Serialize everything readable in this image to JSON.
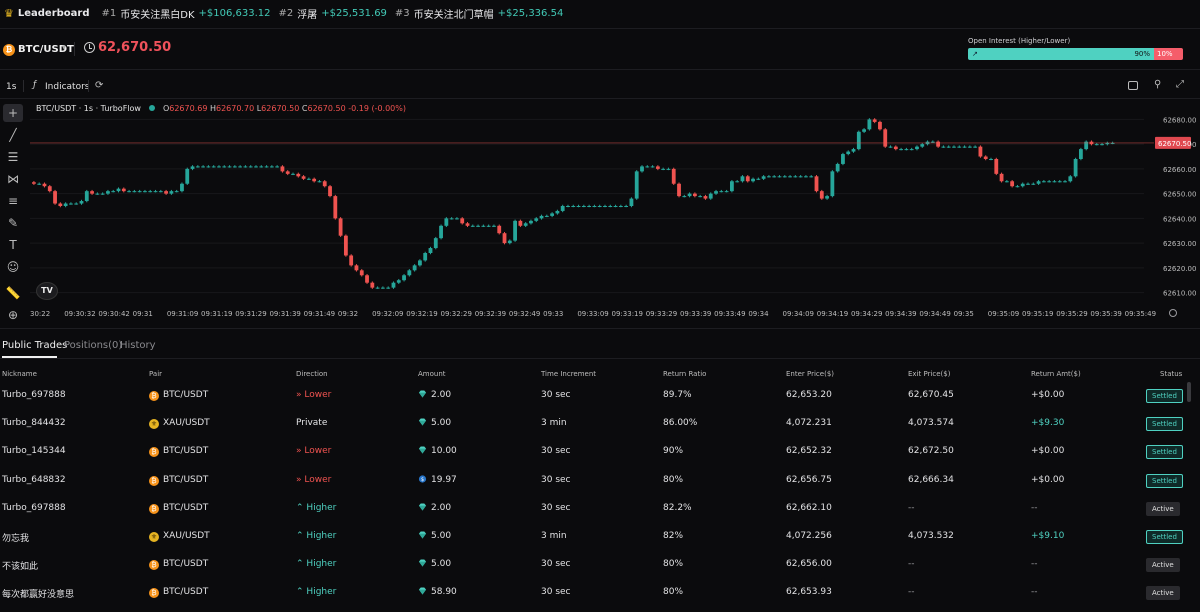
{
  "topbar": {
    "label": "Leaderboard",
    "entries": [
      {
        "rank": "#1",
        "nick": "币安关注黑白DK",
        "amount": "+$106,633.12"
      },
      {
        "rank": "#2",
        "nick": "浮屠",
        "amount": "+$25,531.69"
      },
      {
        "rank": "#3",
        "nick": "币安关注北门草帽",
        "amount": "+$25,336.54"
      }
    ]
  },
  "pair": {
    "symbol_icon": "₿",
    "name": "BTC/USDT",
    "price": "62,670.50"
  },
  "open_interest": {
    "label": "Open Interest (Higher/Lower)",
    "higher": "90%",
    "lower": "10%",
    "higher_fraction": 0.9
  },
  "toolbar": {
    "interval": "1s",
    "indicators": "Indicators"
  },
  "legend": {
    "title": "BTC/USDT · 1s · TurboFlow",
    "o_label": "O",
    "o": "62670.69",
    "h_label": "H",
    "h": "62670.70",
    "l_label": "L",
    "l": "62670.50",
    "c_label": "C",
    "c": "62670.50",
    "change": "-0.19 (-0.00%)"
  },
  "chart_data": {
    "type": "candlestick",
    "y_ticks": [
      62680,
      62670,
      62660,
      62650,
      62640,
      62630,
      62620,
      62610
    ],
    "y_tick_labels": [
      "62680.00",
      "62670.00",
      "62660.00",
      "62650.00",
      "62640.00",
      "62630.00",
      "62620.00",
      "62610.00"
    ],
    "ylim": [
      62607,
      62683
    ],
    "current_price_label": "62670.50",
    "current_price": 62670.5,
    "x_tick_labels": [
      "30:22",
      "09:30:32",
      "09:30:42",
      "09:31",
      "09:31:09",
      "09:31:19",
      "09:31:29",
      "09:31:39",
      "09:31:49",
      "09:32",
      "09:32:09",
      "09:32:19",
      "09:32:29",
      "09:32:39",
      "09:32:49",
      "09:33",
      "09:33:09",
      "09:33:19",
      "09:33:29",
      "09:33:39",
      "09:33:49",
      "09:34",
      "09:34:09",
      "09:34:19",
      "09:34:29",
      "09:34:39",
      "09:34:49",
      "09:35",
      "09:35:09",
      "09:35:19",
      "09:35:29",
      "09:35:39",
      "09:35:49"
    ],
    "closes": [
      62654,
      62654,
      62653,
      62651,
      62646,
      62645,
      62646,
      62646,
      62646,
      62647,
      62651,
      62650,
      62650,
      62650,
      62651,
      62651,
      62652,
      62651,
      62651,
      62651,
      62651,
      62651,
      62651,
      62651,
      62651,
      62650,
      62651,
      62651,
      62654,
      62660,
      62661,
      62661,
      62661,
      62661,
      62661,
      62661,
      62661,
      62661,
      62661,
      62661,
      62661,
      62661,
      62661,
      62661,
      62661,
      62661,
      62661,
      62659,
      62658,
      62658,
      62657,
      62656,
      62656,
      62655,
      62655,
      62653,
      62649,
      62640,
      62633,
      62625,
      62621,
      62619,
      62617,
      62614,
      62612,
      62612,
      62612,
      62612,
      62614,
      62615,
      62617,
      62619,
      62621,
      62623,
      62626,
      62628,
      62632,
      62637,
      62640,
      62640,
      62640,
      62638,
      62637,
      62637,
      62637,
      62637,
      62637,
      62637,
      62634,
      62630,
      62631,
      62639,
      62637,
      62638,
      62639,
      62640,
      62641,
      62641,
      62642,
      62643,
      62645,
      62645,
      62645,
      62645,
      62645,
      62645,
      62645,
      62645,
      62645,
      62645,
      62645,
      62645,
      62645,
      62648,
      62659,
      62661,
      62661,
      62661,
      62660,
      62660,
      62660,
      62654,
      62649,
      62649,
      62650,
      62649,
      62649,
      62648,
      62650,
      62651,
      62651,
      62651,
      62655,
      62655,
      62657,
      62655,
      62656,
      62656,
      62657,
      62657,
      62657,
      62657,
      62657,
      62657,
      62657,
      62657,
      62657,
      62657,
      62651,
      62648,
      62649,
      62659,
      62662,
      62666,
      62667,
      62668,
      62675,
      62676,
      62680,
      62679,
      62676,
      62669,
      62669,
      62668,
      62668,
      62668,
      62668,
      62669,
      62670,
      62671,
      62671,
      62669,
      62669,
      62669,
      62669,
      62669,
      62669,
      62669,
      62669,
      62665,
      62664,
      62664,
      62658,
      62655,
      62655,
      62653,
      62653,
      62654,
      62654,
      62654,
      62655,
      62655,
      62655,
      62655,
      62655,
      62655,
      62657,
      62664,
      62668,
      62671,
      62670,
      62670,
      62670,
      62670.5,
      62670.5
    ]
  },
  "tabs": [
    "Public Trades",
    "Positions(0)",
    "History"
  ],
  "table": {
    "headers": [
      "Nickname",
      "Pair",
      "Direction",
      "Amount",
      "Time Increment",
      "Return Ratio",
      "Enter Price($)",
      "Exit Price($)",
      "Return Amt($)",
      "Status"
    ],
    "rows": [
      {
        "nickname": "Turbo_697888",
        "pair": "BTC/USDT",
        "coin": "btc",
        "direction": "Lower",
        "dir": "lower",
        "amount": "2.00",
        "amt_icon": "gem",
        "time": "30 sec",
        "ratio": "89.7%",
        "enter": "62,653.20",
        "exit": "62,670.45",
        "ret": "+$0.00",
        "ret_color": "white",
        "status": "Settled"
      },
      {
        "nickname": "Turbo_844432",
        "pair": "XAU/USDT",
        "coin": "xau",
        "direction": "Private",
        "dir": "private",
        "amount": "5.00",
        "amt_icon": "gem",
        "time": "3 min",
        "ratio": "86.00%",
        "enter": "4,072.231",
        "exit": "4,073.574",
        "ret": "+$9.30",
        "ret_color": "green",
        "status": "Settled"
      },
      {
        "nickname": "Turbo_145344",
        "pair": "BTC/USDT",
        "coin": "btc",
        "direction": "Lower",
        "dir": "lower",
        "amount": "10.00",
        "amt_icon": "gem",
        "time": "30 sec",
        "ratio": "90%",
        "enter": "62,652.32",
        "exit": "62,672.50",
        "ret": "+$0.00",
        "ret_color": "white",
        "status": "Settled"
      },
      {
        "nickname": "Turbo_648832",
        "pair": "BTC/USDT",
        "coin": "btc",
        "direction": "Lower",
        "dir": "lower",
        "amount": "19.97",
        "amt_icon": "usdc",
        "time": "30 sec",
        "ratio": "80%",
        "enter": "62,656.75",
        "exit": "62,666.34",
        "ret": "+$0.00",
        "ret_color": "white",
        "status": "Settled"
      },
      {
        "nickname": "Turbo_697888",
        "pair": "BTC/USDT",
        "coin": "btc",
        "direction": "Higher",
        "dir": "higher",
        "amount": "2.00",
        "amt_icon": "gem",
        "time": "30 sec",
        "ratio": "82.2%",
        "enter": "62,662.10",
        "exit": "--",
        "ret": "--",
        "ret_color": "dim",
        "status": "Active"
      },
      {
        "nickname": "勿忘我",
        "pair": "XAU/USDT",
        "coin": "xau",
        "direction": "Higher",
        "dir": "higher",
        "amount": "5.00",
        "amt_icon": "gem",
        "time": "3 min",
        "ratio": "82%",
        "enter": "4,072.256",
        "exit": "4,073.532",
        "ret": "+$9.10",
        "ret_color": "green",
        "status": "Settled"
      },
      {
        "nickname": "不该如此",
        "pair": "BTC/USDT",
        "coin": "btc",
        "direction": "Higher",
        "dir": "higher",
        "amount": "5.00",
        "amt_icon": "gem",
        "time": "30 sec",
        "ratio": "80%",
        "enter": "62,656.00",
        "exit": "--",
        "ret": "--",
        "ret_color": "dim",
        "status": "Active"
      },
      {
        "nickname": "每次都赢好没意思",
        "pair": "BTC/USDT",
        "coin": "btc",
        "direction": "Higher",
        "dir": "higher",
        "amount": "58.90",
        "amt_icon": "gem",
        "time": "30 sec",
        "ratio": "80%",
        "enter": "62,653.93",
        "exit": "--",
        "ret": "--",
        "ret_color": "dim",
        "status": "Active"
      }
    ]
  },
  "colors": {
    "up": "#26a69a",
    "down": "#ef5350",
    "price_line": "#ef5350",
    "accent": "#4fd1c1",
    "background": "#0b0b0d"
  }
}
